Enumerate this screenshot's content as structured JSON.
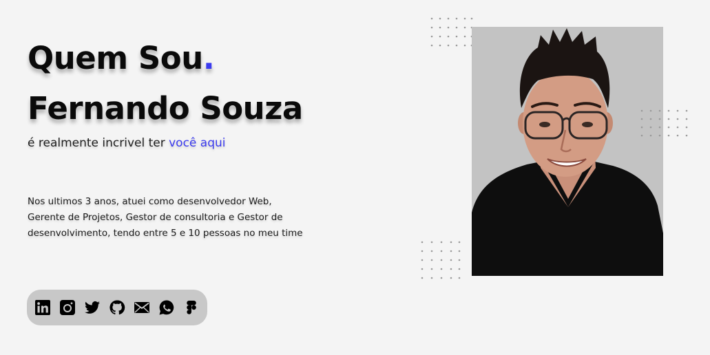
{
  "hero": {
    "title": "Quem Sou",
    "title_dot": ".",
    "name": "Fernando Souza",
    "tagline_prefix": "é realmente incrivel ter ",
    "tagline_highlight": "você aqui",
    "bio": "Nos ultimos 3 anos, atuei como desenvolvedor Web, Gerente de Projetos, Gestor de consultoria e Gestor de desenvolvimento, tendo entre 5 e 10 pessoas no meu time"
  },
  "social": {
    "items": [
      {
        "icon": "linkedin-icon"
      },
      {
        "icon": "instagram-icon"
      },
      {
        "icon": "twitter-icon"
      },
      {
        "icon": "github-icon"
      },
      {
        "icon": "email-icon"
      },
      {
        "icon": "whatsapp-icon"
      },
      {
        "icon": "figma-icon"
      }
    ]
  },
  "colors": {
    "accent": "#3b3bef",
    "background": "#f4f4f4",
    "social_bar": "#c8c8c8",
    "photo_bg": "#c3c3c3"
  }
}
